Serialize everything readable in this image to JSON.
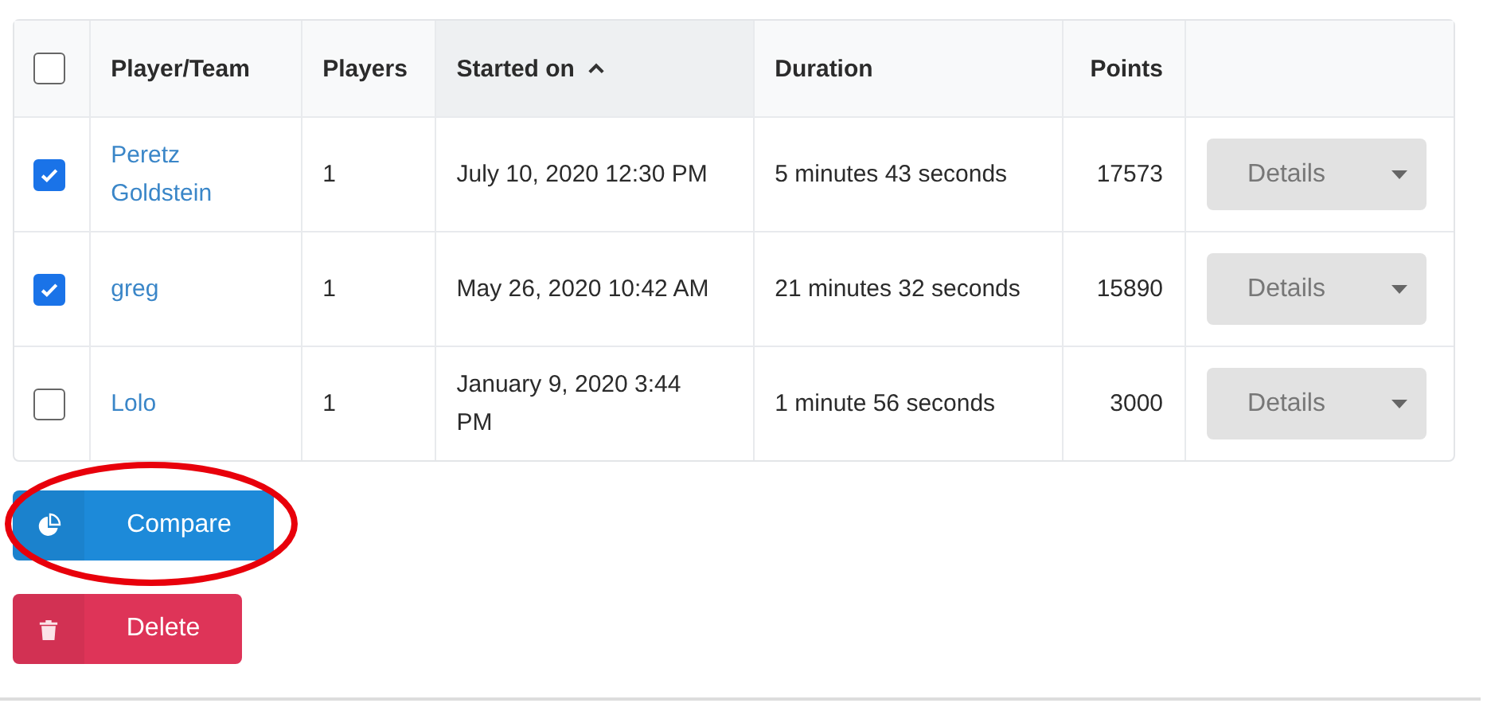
{
  "table": {
    "select_all": {
      "checked": false
    },
    "columns": [
      {
        "label": "Player/Team",
        "sorted": false
      },
      {
        "label": "Players",
        "sorted": false
      },
      {
        "label": "Started on",
        "sorted": true
      },
      {
        "label": "Duration",
        "sorted": false
      },
      {
        "label": "Points",
        "sorted": false
      }
    ],
    "rows": [
      {
        "checked": true,
        "player": "Peretz Goldstein",
        "players": "1",
        "started_on": "July 10, 2020 12:30 PM",
        "duration": "5 minutes 43 seconds",
        "points": "17573",
        "action": "Details"
      },
      {
        "checked": true,
        "player": "greg",
        "players": "1",
        "started_on": "May 26, 2020 10:42 AM",
        "duration": "21 minutes 32 seconds",
        "points": "15890",
        "action": "Details"
      },
      {
        "checked": false,
        "player": "Lolo",
        "players": "1",
        "started_on": "January 9, 2020 3:44 PM",
        "duration": "1 minute 56 seconds",
        "points": "3000",
        "action": "Details"
      }
    ]
  },
  "buttons": [
    {
      "kind": "compare",
      "label": "Compare",
      "highlighted": true
    },
    {
      "kind": "delete",
      "label": "Delete",
      "highlighted": false
    }
  ]
}
